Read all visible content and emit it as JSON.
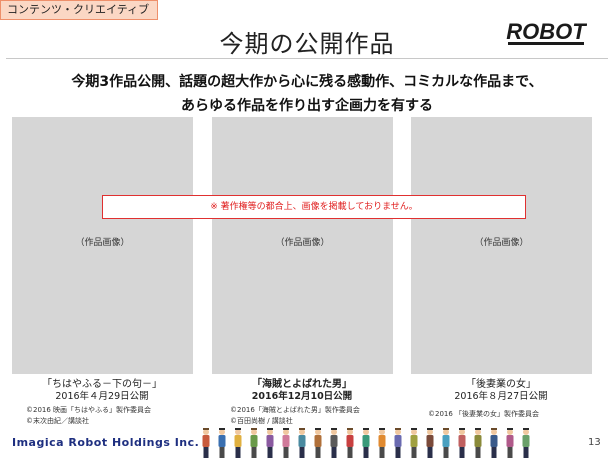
{
  "header": {
    "tag": "コンテンツ・クリエイティブ",
    "title": "今期の公開作品",
    "logo": "ROBOT",
    "logo_color": "#1a1a1a"
  },
  "lead": {
    "line1": "今期3作品公開、話題の超大作から心に残る感動作、コミカルな作品まで、",
    "line2": "あらゆる作品を作り出す企画力を有する"
  },
  "notice": "※ 著作権等の都合上、画像を掲載しておりません。",
  "works": [
    {
      "placeholder": "（作品画像）",
      "title": "「ちはやふる－下の句－」",
      "date": "2016年４月29日公開",
      "credits": [
        "©2016 映画「ちはやふる」製作委員会",
        "©末次由紀／講談社"
      ]
    },
    {
      "placeholder": "（作品画像）",
      "title": "「海賊とよばれた男」",
      "date": "2016年12月10日公開",
      "credits": [
        "©2016「海賊とよばれた男」製作委員会",
        "©百田尚樹 / 講談社"
      ]
    },
    {
      "placeholder": "（作品画像）",
      "title": "「後妻業の女」",
      "date": "2016年８月27日公開",
      "credits": [
        "©2016 「後妻業の女」製作委員会"
      ]
    }
  ],
  "footer": {
    "company": "Imagica Robot Holdings Inc.",
    "page_number": "13",
    "people_icon": "people-illustration",
    "brand_color": "#1e2f80"
  },
  "colors": {
    "tag_bg": "#fbd7c4",
    "tag_border": "#ee8f6a",
    "panel": "#d6d6d6",
    "notice": "#e02020"
  }
}
